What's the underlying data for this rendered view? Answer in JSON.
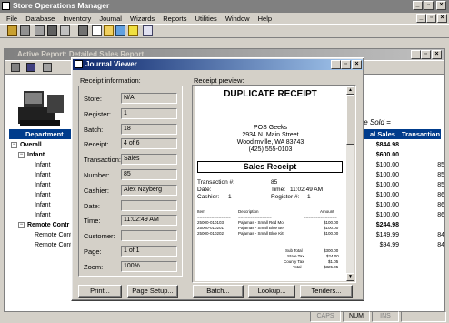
{
  "app": {
    "title": "Store Operations Manager",
    "menu": [
      "File",
      "Database",
      "Inventory",
      "Journal",
      "Wizards",
      "Reports",
      "Utilities",
      "Window",
      "Help"
    ]
  },
  "report_window": {
    "title": "Active Report: Detailed Sales Report",
    "time_sold": "te Sold =",
    "headers": {
      "department": "Department",
      "total_sales": "al Sales",
      "transaction": "Transaction"
    },
    "rows": [
      {
        "label": "Overall",
        "sales": "$844.98",
        "txn": "",
        "bold": true,
        "indent": 0,
        "expand": true
      },
      {
        "label": "Infant",
        "sales": "$600.00",
        "txn": "",
        "bold": true,
        "indent": 1,
        "expand": true
      },
      {
        "label": "Infant",
        "sales": "$100.00",
        "txn": "85",
        "bold": false,
        "indent": 2
      },
      {
        "label": "Infant",
        "sales": "$100.00",
        "txn": "85",
        "bold": false,
        "indent": 2
      },
      {
        "label": "Infant",
        "sales": "$100.00",
        "txn": "85",
        "bold": false,
        "indent": 2
      },
      {
        "label": "Infant",
        "sales": "$100.00",
        "txn": "86",
        "bold": false,
        "indent": 2
      },
      {
        "label": "Infant",
        "sales": "$100.00",
        "txn": "86",
        "bold": false,
        "indent": 2
      },
      {
        "label": "Infant",
        "sales": "$100.00",
        "txn": "86",
        "bold": false,
        "indent": 2
      },
      {
        "label": "Remote Contr",
        "sales": "$244.98",
        "txn": "",
        "bold": true,
        "indent": 1,
        "expand": true
      },
      {
        "label": "Remote Control",
        "sales": "$149.99",
        "txn": "84",
        "bold": false,
        "indent": 2
      },
      {
        "label": "Remote Control",
        "sales": "$94.99",
        "txn": "84",
        "bold": false,
        "indent": 2
      }
    ]
  },
  "journal": {
    "title": "Journal Viewer",
    "receipt_info_label": "Receipt information:",
    "receipt_preview_label": "Receipt preview:",
    "fields": [
      {
        "label": "Store:",
        "value": "N/A"
      },
      {
        "label": "Register:",
        "value": "1"
      },
      {
        "label": "Batch:",
        "value": "18"
      },
      {
        "label": "Receipt:",
        "value": "4 of 6"
      },
      {
        "label": "Transaction:",
        "value": "Sales"
      },
      {
        "label": "Number:",
        "value": "85"
      },
      {
        "label": "Cashier:",
        "value": "Alex Nayberg"
      },
      {
        "label": "Date:",
        "value": ""
      },
      {
        "label": "Time:",
        "value": "11:02:49 AM"
      },
      {
        "label": "Customer:",
        "value": ""
      },
      {
        "label": "Page:",
        "value": "1 of 1"
      },
      {
        "label": "Zoom:",
        "value": "100%"
      }
    ],
    "buttons": {
      "print": "Print...",
      "page_setup": "Page Setup...",
      "batch": "Batch...",
      "lookup": "Lookup...",
      "tenders": "Tenders..."
    }
  },
  "receipt": {
    "dup": "DUPLICATE RECEIPT",
    "store": "POS Geeks",
    "addr1": "2934 N. Main Street",
    "addr2": "Woodlmville, WA  83743",
    "phone": "(425) 555-0103",
    "heading": "Sales Receipt",
    "txn_label": "Transaction #:",
    "txn_val": "85",
    "date_label": "Date:",
    "time_label": "Time:",
    "time_val": "11:02:49 AM",
    "cashier_label": "Cashier:",
    "cashier_val": "1",
    "register_label": "Register #:",
    "register_val": "1",
    "col_item": "Item",
    "col_desc": "Description",
    "col_amt": "Amount",
    "sep": "==============",
    "items": [
      {
        "item": "25000-010103",
        "desc": "Pajamas - Small Red Mo",
        "amt": "$100.00"
      },
      {
        "item": "25000-010201",
        "desc": "Pajamas - Small Blue Be",
        "amt": "$100.00"
      },
      {
        "item": "25000-010202",
        "desc": "Pajamas - Small Blue Kitt",
        "amt": "$100.00"
      }
    ],
    "subtotal_label": "Sub Total",
    "subtotal": "$300.00",
    "state_label": "State Tax",
    "state": "$24.00",
    "county_label": "County Tax",
    "county": "$1.05",
    "total_label": "Total",
    "total": "$325.05"
  },
  "status": {
    "caps": "CAPS",
    "num": "NUM",
    "ins": "INS"
  }
}
